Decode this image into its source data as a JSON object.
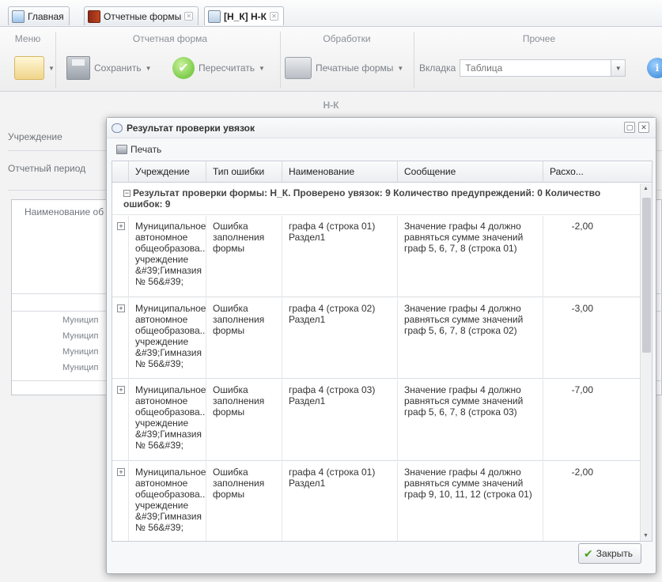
{
  "tabs": [
    {
      "label": "Главная"
    },
    {
      "label": "Отчетные формы"
    },
    {
      "label": "[Н_К] Н-К"
    }
  ],
  "ribbon": {
    "groups": {
      "menu": "Меню",
      "report_form": "Отчетная форма",
      "processing": "Обработки",
      "other": "Прочее"
    },
    "save_label": "Сохранить",
    "recalc_label": "Пересчитать",
    "print_forms_label": "Печатные формы",
    "tab_label": "Вкладка",
    "tab_value": "Таблица",
    "info_icon_glyph": "i"
  },
  "background": {
    "form_title": "Н-К",
    "institution_label": "Учреждение",
    "period_label": "Отчетный период",
    "table_header": "Наименование об",
    "rows": [
      "Муницип",
      "Муницип",
      "Муницип",
      "Муницип"
    ]
  },
  "dialog": {
    "title": "Результат проверки увязок",
    "print_label": "Печать",
    "columns": [
      "Учреждение",
      "Тип ошибки",
      "Наименование",
      "Сообщение",
      "Расхо..."
    ],
    "group_text": "Результат проверки формы: Н_К. Проверено увязок: 9 Количество предупреждений: 0 Количество ошибок: 9",
    "rows": [
      {
        "institution": "Муниципальное автономное общеобразова... учреждение &#39;Гимназия № 56&#39;",
        "error_type": "Ошибка заполнения формы",
        "name": "графа 4 (строка 01) Раздел1",
        "message": "Значение графы 4 должно равняться сумме значений граф 5, 6, 7, 8 (строка 01)",
        "value": "-2,00"
      },
      {
        "institution": "Муниципальное автономное общеобразова... учреждение &#39;Гимназия № 56&#39;",
        "error_type": "Ошибка заполнения формы",
        "name": "графа 4 (строка 02) Раздел1",
        "message": "Значение графы 4 должно равняться сумме значений граф 5, 6, 7, 8 (строка 02)",
        "value": "-3,00"
      },
      {
        "institution": "Муниципальное автономное общеобразова... учреждение &#39;Гимназия № 56&#39;",
        "error_type": "Ошибка заполнения формы",
        "name": "графа 4 (строка 03) Раздел1",
        "message": "Значение графы 4 должно равняться сумме значений граф 5, 6, 7, 8 (строка 03)",
        "value": "-7,00"
      },
      {
        "institution": "Муниципальное автономное общеобразова... учреждение &#39;Гимназия № 56&#39;",
        "error_type": "Ошибка заполнения формы",
        "name": "графа 4 (строка 01) Раздел1",
        "message": "Значение графы 4 должно равняться сумме значений граф 9, 10, 11, 12 (строка 01)",
        "value": "-2,00"
      }
    ],
    "close_label": "Закрыть"
  }
}
